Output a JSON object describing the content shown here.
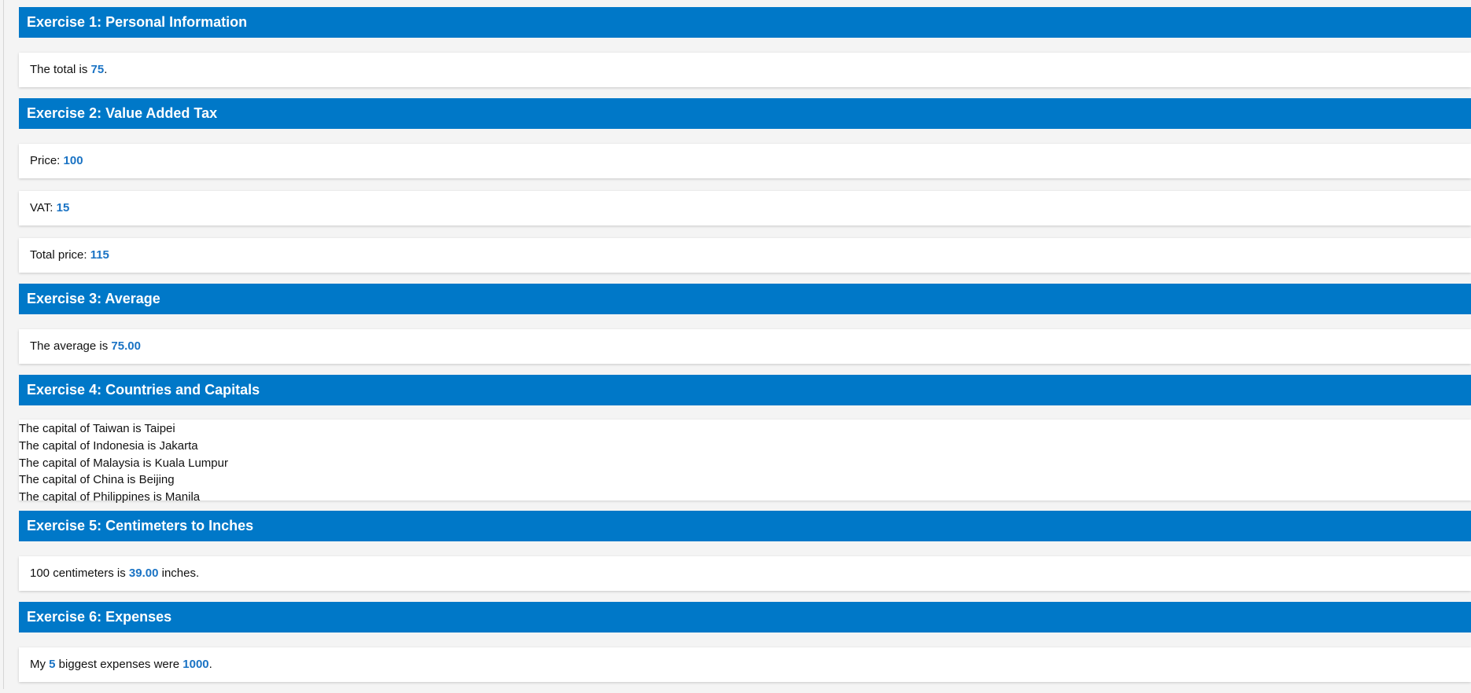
{
  "colors": {
    "header_bg": "#0078c8",
    "header_text": "#ffffff",
    "value_accent": "#1a73c4",
    "page_bg": "#f4f4f4",
    "card_bg": "#ffffff"
  },
  "ex1": {
    "title": "Exercise 1: Personal Information",
    "text_before": "The total is ",
    "value": "75",
    "text_after": "."
  },
  "ex2": {
    "title": "Exercise 2: Value Added Tax",
    "price_label": "Price: ",
    "price_value": "100",
    "vat_label": "VAT: ",
    "vat_value": "15",
    "total_label": "Total price: ",
    "total_value": "115"
  },
  "ex3": {
    "title": "Exercise 3: Average",
    "text_before": "The average is ",
    "value": "75.00"
  },
  "ex4": {
    "title": "Exercise 4: Countries and Capitals",
    "lines": [
      "The capital of Taiwan is Taipei",
      "The capital of Indonesia is Jakarta",
      "The capital of Malaysia is Kuala Lumpur",
      "The capital of China is Beijing",
      "The capital of Philippines is Manila"
    ]
  },
  "ex5": {
    "title": "Exercise 5: Centimeters to Inches",
    "text_before": "100 centimeters is ",
    "value": "39.00",
    "text_after": " inches."
  },
  "ex6": {
    "title": "Exercise 6: Expenses",
    "text_before": "My ",
    "count_value": "5",
    "text_middle": " biggest expenses were ",
    "total_value": "1000",
    "text_after": "."
  }
}
